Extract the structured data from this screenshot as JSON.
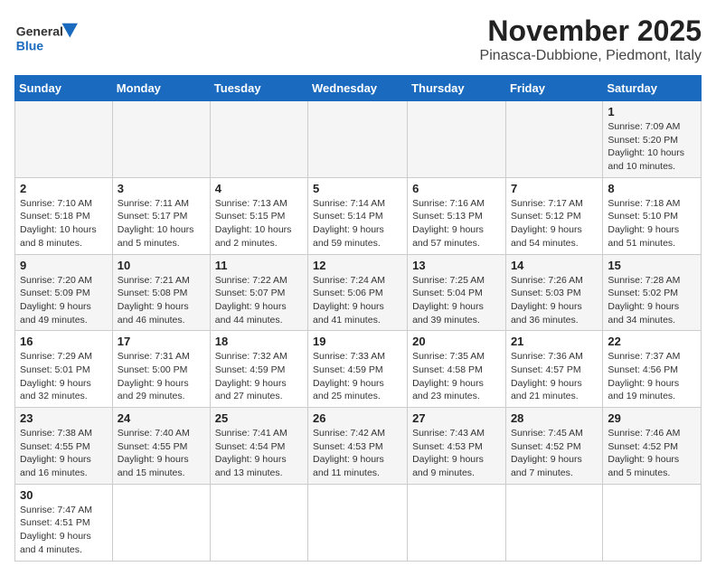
{
  "header": {
    "logo_general": "General",
    "logo_blue": "Blue",
    "month": "November 2025",
    "location": "Pinasca-Dubbione, Piedmont, Italy"
  },
  "days_of_week": [
    "Sunday",
    "Monday",
    "Tuesday",
    "Wednesday",
    "Thursday",
    "Friday",
    "Saturday"
  ],
  "weeks": [
    [
      {
        "day": "",
        "info": ""
      },
      {
        "day": "",
        "info": ""
      },
      {
        "day": "",
        "info": ""
      },
      {
        "day": "",
        "info": ""
      },
      {
        "day": "",
        "info": ""
      },
      {
        "day": "",
        "info": ""
      },
      {
        "day": "1",
        "info": "Sunrise: 7:09 AM\nSunset: 5:20 PM\nDaylight: 10 hours and 10 minutes."
      }
    ],
    [
      {
        "day": "2",
        "info": "Sunrise: 7:10 AM\nSunset: 5:18 PM\nDaylight: 10 hours and 8 minutes."
      },
      {
        "day": "3",
        "info": "Sunrise: 7:11 AM\nSunset: 5:17 PM\nDaylight: 10 hours and 5 minutes."
      },
      {
        "day": "4",
        "info": "Sunrise: 7:13 AM\nSunset: 5:15 PM\nDaylight: 10 hours and 2 minutes."
      },
      {
        "day": "5",
        "info": "Sunrise: 7:14 AM\nSunset: 5:14 PM\nDaylight: 9 hours and 59 minutes."
      },
      {
        "day": "6",
        "info": "Sunrise: 7:16 AM\nSunset: 5:13 PM\nDaylight: 9 hours and 57 minutes."
      },
      {
        "day": "7",
        "info": "Sunrise: 7:17 AM\nSunset: 5:12 PM\nDaylight: 9 hours and 54 minutes."
      },
      {
        "day": "8",
        "info": "Sunrise: 7:18 AM\nSunset: 5:10 PM\nDaylight: 9 hours and 51 minutes."
      }
    ],
    [
      {
        "day": "9",
        "info": "Sunrise: 7:20 AM\nSunset: 5:09 PM\nDaylight: 9 hours and 49 minutes."
      },
      {
        "day": "10",
        "info": "Sunrise: 7:21 AM\nSunset: 5:08 PM\nDaylight: 9 hours and 46 minutes."
      },
      {
        "day": "11",
        "info": "Sunrise: 7:22 AM\nSunset: 5:07 PM\nDaylight: 9 hours and 44 minutes."
      },
      {
        "day": "12",
        "info": "Sunrise: 7:24 AM\nSunset: 5:06 PM\nDaylight: 9 hours and 41 minutes."
      },
      {
        "day": "13",
        "info": "Sunrise: 7:25 AM\nSunset: 5:04 PM\nDaylight: 9 hours and 39 minutes."
      },
      {
        "day": "14",
        "info": "Sunrise: 7:26 AM\nSunset: 5:03 PM\nDaylight: 9 hours and 36 minutes."
      },
      {
        "day": "15",
        "info": "Sunrise: 7:28 AM\nSunset: 5:02 PM\nDaylight: 9 hours and 34 minutes."
      }
    ],
    [
      {
        "day": "16",
        "info": "Sunrise: 7:29 AM\nSunset: 5:01 PM\nDaylight: 9 hours and 32 minutes."
      },
      {
        "day": "17",
        "info": "Sunrise: 7:31 AM\nSunset: 5:00 PM\nDaylight: 9 hours and 29 minutes."
      },
      {
        "day": "18",
        "info": "Sunrise: 7:32 AM\nSunset: 4:59 PM\nDaylight: 9 hours and 27 minutes."
      },
      {
        "day": "19",
        "info": "Sunrise: 7:33 AM\nSunset: 4:59 PM\nDaylight: 9 hours and 25 minutes."
      },
      {
        "day": "20",
        "info": "Sunrise: 7:35 AM\nSunset: 4:58 PM\nDaylight: 9 hours and 23 minutes."
      },
      {
        "day": "21",
        "info": "Sunrise: 7:36 AM\nSunset: 4:57 PM\nDaylight: 9 hours and 21 minutes."
      },
      {
        "day": "22",
        "info": "Sunrise: 7:37 AM\nSunset: 4:56 PM\nDaylight: 9 hours and 19 minutes."
      }
    ],
    [
      {
        "day": "23",
        "info": "Sunrise: 7:38 AM\nSunset: 4:55 PM\nDaylight: 9 hours and 16 minutes."
      },
      {
        "day": "24",
        "info": "Sunrise: 7:40 AM\nSunset: 4:55 PM\nDaylight: 9 hours and 15 minutes."
      },
      {
        "day": "25",
        "info": "Sunrise: 7:41 AM\nSunset: 4:54 PM\nDaylight: 9 hours and 13 minutes."
      },
      {
        "day": "26",
        "info": "Sunrise: 7:42 AM\nSunset: 4:53 PM\nDaylight: 9 hours and 11 minutes."
      },
      {
        "day": "27",
        "info": "Sunrise: 7:43 AM\nSunset: 4:53 PM\nDaylight: 9 hours and 9 minutes."
      },
      {
        "day": "28",
        "info": "Sunrise: 7:45 AM\nSunset: 4:52 PM\nDaylight: 9 hours and 7 minutes."
      },
      {
        "day": "29",
        "info": "Sunrise: 7:46 AM\nSunset: 4:52 PM\nDaylight: 9 hours and 5 minutes."
      }
    ],
    [
      {
        "day": "30",
        "info": "Sunrise: 7:47 AM\nSunset: 4:51 PM\nDaylight: 9 hours and 4 minutes."
      },
      {
        "day": "",
        "info": ""
      },
      {
        "day": "",
        "info": ""
      },
      {
        "day": "",
        "info": ""
      },
      {
        "day": "",
        "info": ""
      },
      {
        "day": "",
        "info": ""
      },
      {
        "day": "",
        "info": ""
      }
    ]
  ]
}
